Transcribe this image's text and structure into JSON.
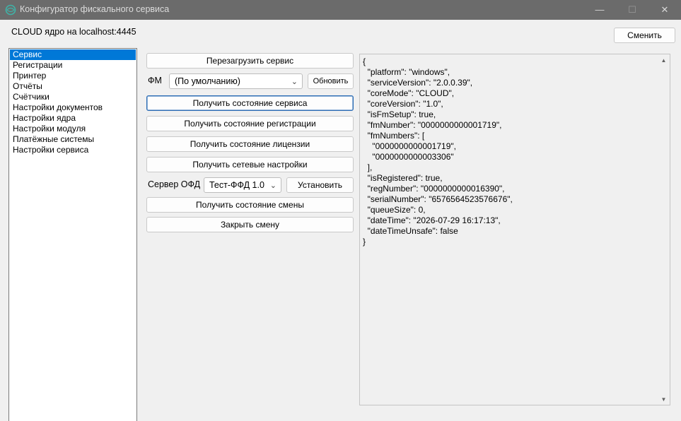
{
  "window": {
    "title": "Конфигуратор фискального сервиса",
    "minimize": "—",
    "maximize": "☐",
    "close": "✕"
  },
  "header": {
    "host_label": "CLOUD ядро на localhost:4445",
    "change_button": "Сменить"
  },
  "sidebar": {
    "items": [
      {
        "label": "Сервис",
        "selected": true
      },
      {
        "label": "Регистрации"
      },
      {
        "label": "Принтер"
      },
      {
        "label": "Отчёты"
      },
      {
        "label": "Счётчики"
      },
      {
        "label": "Настройки документов"
      },
      {
        "label": "Настройки ядра"
      },
      {
        "label": "Настройки модуля"
      },
      {
        "label": "Платёжные системы"
      },
      {
        "label": "Настройки сервиса"
      }
    ]
  },
  "actions": {
    "restart": "Перезагрузить сервис",
    "fm_label": "ФМ",
    "fm_selected": "(По умолчанию)",
    "refresh": "Обновить",
    "get_service_state": "Получить состояние сервиса",
    "get_registration_state": "Получить состояние регистрации",
    "get_license_state": "Получить состояние лицензии",
    "get_network_settings": "Получить сетевые настройки",
    "ofd_label": "Сервер ОФД",
    "ofd_selected": "Тест-ФФД 1.0",
    "install": "Установить",
    "get_shift_state": "Получить состояние смены",
    "close_shift": "Закрыть смену"
  },
  "output": {
    "text": "{\n  \"platform\": \"windows\",\n  \"serviceVersion\": \"2.0.0.39\",\n  \"coreMode\": \"CLOUD\",\n  \"coreVersion\": \"1.0\",\n  \"isFmSetup\": true,\n  \"fmNumber\": \"0000000000001719\",\n  \"fmNumbers\": [\n    \"0000000000001719\",\n    \"0000000000003306\"\n  ],\n  \"isRegistered\": true,\n  \"regNumber\": \"0000000000016390\",\n  \"serialNumber\": \"6576564523576676\",\n  \"queueSize\": 0,\n  \"dateTime\": \"2026-07-29 16:17:13\",\n  \"dateTimeUnsafe\": false\n}"
  },
  "icons": {
    "app": "app-logo-icon",
    "combo_arrow": "chevron-down-icon",
    "scroll_up": "scroll-up-arrow-icon",
    "scroll_down": "scroll-down-arrow-icon"
  },
  "colors": {
    "titlebar": "#6b6b6b",
    "selection": "#0078d7",
    "focus_border": "#2d6db5"
  }
}
